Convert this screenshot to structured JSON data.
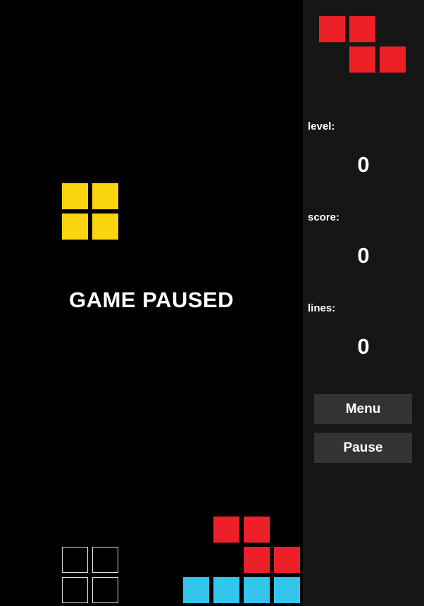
{
  "game": {
    "status_text": "GAME PAUSED",
    "colors": {
      "board_bg": "#000000",
      "sidebar_bg": "#161616",
      "button_bg": "#333333",
      "red": "#ed2027",
      "yellow": "#fad40d",
      "cyan": "#33c5ec",
      "ghost_outline": "#e0e0e0"
    },
    "pieces": {
      "active": {
        "type": "O",
        "color": "yellow"
      },
      "ghost": {
        "type": "O"
      },
      "next": {
        "type": "Z",
        "color": "red"
      },
      "settled": [
        {
          "type": "Z",
          "color": "red"
        },
        {
          "type": "I",
          "color": "cyan"
        }
      ]
    }
  },
  "sidebar": {
    "level_label": "level:",
    "level_value": "0",
    "score_label": "score:",
    "score_value": "0",
    "lines_label": "lines:",
    "lines_value": "0",
    "menu_label": "Menu",
    "pause_label": "Pause"
  }
}
